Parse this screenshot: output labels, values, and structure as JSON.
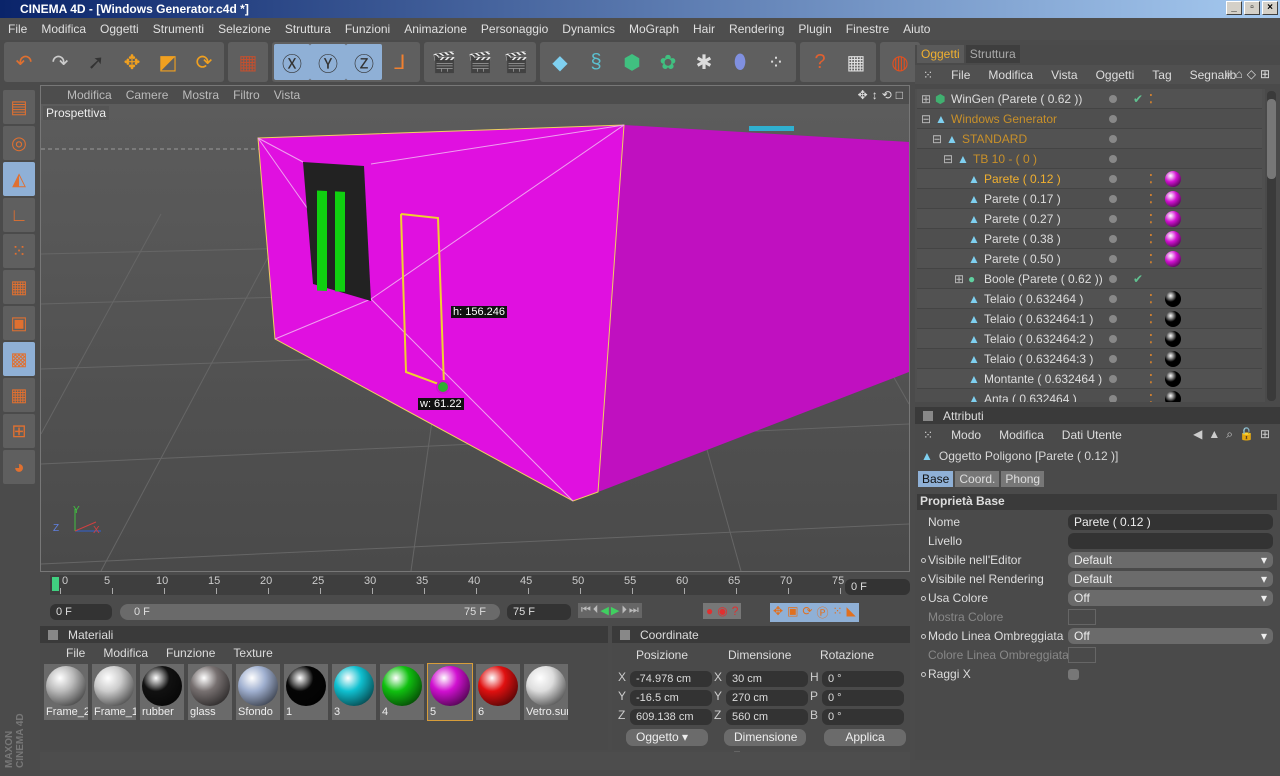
{
  "window": {
    "title": "CINEMA 4D - [Windows Generator.c4d *]",
    "buttons": [
      "_",
      "▫",
      "×"
    ]
  },
  "menubar": [
    "File",
    "Modifica",
    "Oggetti",
    "Strumenti",
    "Selezione",
    "Struttura",
    "Funzioni",
    "Animazione",
    "Personaggio",
    "Dynamics",
    "MoGraph",
    "Hair",
    "Rendering",
    "Plugin",
    "Finestre",
    "Aiuto"
  ],
  "toolbar": {
    "groups": [
      [
        {
          "icon": "undo-icon",
          "g": "↶",
          "c": "#e07030"
        },
        {
          "icon": "redo-icon",
          "g": "↷",
          "c": "#ccc"
        },
        {
          "icon": "live-selection-icon",
          "g": "➚",
          "c": "#333"
        },
        {
          "icon": "move-icon",
          "g": "✥",
          "c": "#f0a020"
        },
        {
          "icon": "scale-icon",
          "g": "◩",
          "c": "#f0a020"
        },
        {
          "icon": "rotate-icon",
          "g": "⟳",
          "c": "#f0a020"
        }
      ],
      [
        {
          "icon": "coordinate-system-icon",
          "g": "▦",
          "c": "#c05030"
        }
      ],
      [
        {
          "icon": "x-axis-lock-icon",
          "g": "Ⓧ",
          "c": "#333",
          "on": true
        },
        {
          "icon": "y-axis-lock-icon",
          "g": "Ⓨ",
          "c": "#333",
          "on": true
        },
        {
          "icon": "z-axis-lock-icon",
          "g": "Ⓩ",
          "c": "#333",
          "on": true
        },
        {
          "icon": "world-coordinates-icon",
          "g": "⅃",
          "c": "#f08030"
        }
      ],
      [
        {
          "icon": "render-view-icon",
          "g": "🎬",
          "c": "#eee"
        },
        {
          "icon": "render-picture-viewer-icon",
          "g": "🎬",
          "c": "#e06030"
        },
        {
          "icon": "render-settings-icon",
          "g": "🎬",
          "c": "#eee"
        }
      ],
      [
        {
          "icon": "cube-icon",
          "g": "◆",
          "c": "#7fd0f0"
        },
        {
          "icon": "spline-icon",
          "g": "§",
          "c": "#5bc0d0"
        },
        {
          "icon": "nurbs-icon",
          "g": "⬢",
          "c": "#40c080"
        },
        {
          "icon": "array-icon",
          "g": "✿",
          "c": "#40c080"
        },
        {
          "icon": "deformer-icon",
          "g": "✱",
          "c": "#ddd"
        },
        {
          "icon": "environment-icon",
          "g": "⬮",
          "c": "#8090e0"
        },
        {
          "icon": "particles-icon",
          "g": "⁘",
          "c": "#ddd"
        }
      ],
      [
        {
          "icon": "help-icon",
          "g": "?",
          "c": "#e06030"
        },
        {
          "icon": "timeline-help-icon",
          "g": "▦",
          "c": "#ddd"
        }
      ],
      [
        {
          "icon": "render-globe-icon",
          "g": "◍",
          "c": "#e05020"
        }
      ]
    ]
  },
  "lefttools": [
    {
      "icon": "layout-icon",
      "g": "▤"
    },
    {
      "icon": "use-model-icon",
      "g": "◎"
    },
    {
      "icon": "object-mode-icon",
      "g": "◭",
      "on": true
    },
    {
      "icon": "axis-mode-icon",
      "g": "∟"
    },
    {
      "icon": "points-mode-icon",
      "g": "⁙"
    },
    {
      "icon": "edges-mode-icon",
      "g": "▦"
    },
    {
      "icon": "polygons-mode-icon",
      "g": "▣"
    },
    {
      "icon": "uvw-mode-icon",
      "g": "▩",
      "on": true
    },
    {
      "icon": "texture-mode-icon",
      "g": "▦"
    },
    {
      "icon": "workplane-icon",
      "g": "⊞"
    },
    {
      "icon": "sculpt-icon",
      "g": "◕"
    }
  ],
  "viewport": {
    "menu": [
      "Modifica",
      "Camere",
      "Mostra",
      "Filtro",
      "Vista"
    ],
    "label": "Prospettiva",
    "nav_icons": [
      "move-view-icon",
      "zoom-view-icon",
      "rotate-view-icon",
      "maximize-view-icon"
    ],
    "h_label": "h: 156.246",
    "w_label": "w: 61.22",
    "axis": {
      "x": "X",
      "y": "Y",
      "z": "Z"
    },
    "object_color": "#e010e0"
  },
  "timeline": {
    "ticks": [
      "0",
      "5",
      "10",
      "15",
      "20",
      "25",
      "30",
      "35",
      "40",
      "45",
      "50",
      "55",
      "60",
      "65",
      "70",
      "75"
    ],
    "current": "0 F",
    "start": "0 F",
    "range_start": "0 F",
    "range_end": "75 F",
    "end": "75 F"
  },
  "materials": {
    "title": "Materiali",
    "menu": [
      "File",
      "Modifica",
      "Funzione",
      "Texture"
    ],
    "items": [
      {
        "name": "Frame_2",
        "color": "#bbbbbb"
      },
      {
        "name": "Frame_1",
        "color": "#cccccc"
      },
      {
        "name": "rubber",
        "color": "#111111"
      },
      {
        "name": "glass",
        "color": "#777070"
      },
      {
        "name": "Sfondo",
        "color": "#a0b0d0"
      },
      {
        "name": "1",
        "color": "#050505"
      },
      {
        "name": "3",
        "color": "#10c0d0"
      },
      {
        "name": "4",
        "color": "#10c010"
      },
      {
        "name": "5",
        "color": "#d010d0",
        "selected": true
      },
      {
        "name": "6",
        "color": "#e01010"
      },
      {
        "name": "Vetro.sur",
        "color": "#dddddd"
      }
    ]
  },
  "coordinates": {
    "title": "Coordinate",
    "headers": [
      "Posizione",
      "Dimensione",
      "Rotazione"
    ],
    "rows": [
      {
        "pl": "X",
        "p": "-74.978 cm",
        "dl": "X",
        "d": "30 cm",
        "rl": "H",
        "r": "0 °"
      },
      {
        "pl": "Y",
        "p": "-16.5 cm",
        "dl": "Y",
        "d": "270 cm",
        "rl": "P",
        "r": "0 °"
      },
      {
        "pl": "Z",
        "p": "609.138 cm",
        "dl": "Z",
        "d": "560 cm",
        "rl": "B",
        "r": "0 °"
      }
    ],
    "mode": "Oggetto",
    "size_mode": "Dimensione",
    "apply": "Applica"
  },
  "objects": {
    "tabs": [
      "Oggetti",
      "Struttura"
    ],
    "menu": [
      "File",
      "Modifica",
      "Vista",
      "Oggetti",
      "Tag",
      "Segnalib"
    ],
    "rows": [
      {
        "name": "WinGen (Parete ( 0.62 ))",
        "indent": 0,
        "color": "#dddddd",
        "check": true,
        "tag": "",
        "expand": "+"
      },
      {
        "name": "Windows Generator",
        "indent": 0,
        "color": "#c8902a",
        "expand": "-"
      },
      {
        "name": "STANDARD",
        "indent": 1,
        "color": "#c8902a",
        "expand": "-"
      },
      {
        "name": "TB 10 -  ( 0 )",
        "indent": 2,
        "color": "#c8902a",
        "expand": "-"
      },
      {
        "name": "Parete ( 0.12 )",
        "indent": 3,
        "color": "#f0b030",
        "tag": "#d010d0"
      },
      {
        "name": "Parete ( 0.17 )",
        "indent": 3,
        "color": "#dddddd",
        "tag": "#d010d0"
      },
      {
        "name": "Parete ( 0.27 )",
        "indent": 3,
        "color": "#dddddd",
        "tag": "#d010d0"
      },
      {
        "name": "Parete ( 0.38 )",
        "indent": 3,
        "color": "#dddddd",
        "tag": "#d010d0"
      },
      {
        "name": "Parete ( 0.50 )",
        "indent": 3,
        "color": "#dddddd",
        "tag": "#d010d0"
      },
      {
        "name": "Boole (Parete ( 0.62 ))",
        "indent": 3,
        "color": "#dddddd",
        "check": true,
        "expand": "+"
      },
      {
        "name": "Telaio ( 0.632464 )",
        "indent": 3,
        "color": "#dddddd",
        "tag": "#000000"
      },
      {
        "name": "Telaio ( 0.632464:1 )",
        "indent": 3,
        "color": "#dddddd",
        "tag": "#000000"
      },
      {
        "name": "Telaio ( 0.632464:2 )",
        "indent": 3,
        "color": "#dddddd",
        "tag": "#000000"
      },
      {
        "name": "Telaio ( 0.632464:3 )",
        "indent": 3,
        "color": "#dddddd",
        "tag": "#000000"
      },
      {
        "name": "Montante ( 0.632464 )",
        "indent": 3,
        "color": "#dddddd",
        "tag": "#000000"
      },
      {
        "name": "Anta ( 0.632464 )",
        "indent": 3,
        "color": "#dddddd",
        "tag": "#000000"
      }
    ]
  },
  "attributes": {
    "title": "Attributi",
    "menu": [
      "Modo",
      "Modifica",
      "Dati Utente"
    ],
    "object": "Oggetto Poligono [Parete ( 0.12 )]",
    "tabs": [
      "Base",
      "Coord.",
      "Phong"
    ],
    "section": "Proprietà Base",
    "fields": [
      {
        "label": "Nome",
        "value": "Parete ( 0.12 )",
        "type": "text"
      },
      {
        "label": "Livello",
        "value": "",
        "type": "level"
      },
      {
        "label": "Visibile nell'Editor",
        "value": "Default",
        "type": "drop",
        "dot": true
      },
      {
        "label": "Visibile nel Rendering",
        "value": "Default",
        "type": "drop",
        "dot": true
      },
      {
        "label": "Usa Colore",
        "value": "Off",
        "type": "drop",
        "dot": true
      },
      {
        "label": "Mostra Colore",
        "value": "",
        "type": "color",
        "disabled": true
      },
      {
        "label": "Modo Linea Ombreggiata",
        "value": "Off",
        "type": "drop",
        "dot": true
      },
      {
        "label": "Colore Linea Ombreggiata",
        "value": "",
        "type": "color",
        "disabled": true
      },
      {
        "label": "Raggi X",
        "value": "",
        "type": "check",
        "dot": true
      }
    ]
  },
  "branding": "MAXON CINEMA 4D"
}
